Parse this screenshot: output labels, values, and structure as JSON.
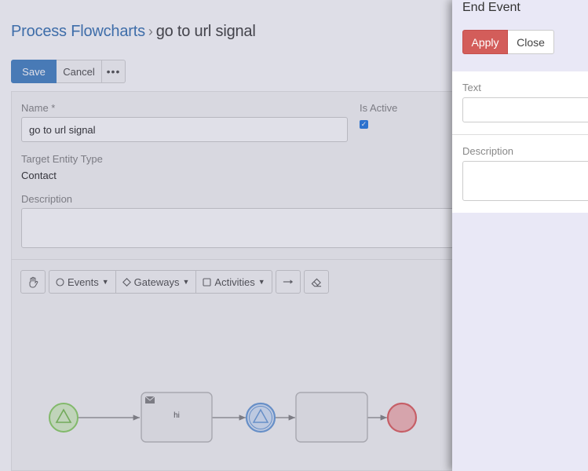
{
  "breadcrumb": {
    "parent": "Process Flowcharts",
    "separator": "›",
    "current": "go to url signal"
  },
  "toolbar": {
    "save_label": "Save",
    "cancel_label": "Cancel",
    "more_label": "•••"
  },
  "form": {
    "name_label": "Name *",
    "name_value": "go to url signal",
    "is_active_label": "Is Active",
    "is_active_checked": true,
    "target_entity_label": "Target Entity Type",
    "target_entity_value": "Contact",
    "description_label": "Description",
    "description_value": ""
  },
  "flow_toolbar": {
    "events_label": "Events",
    "gateways_label": "Gateways",
    "activities_label": "Activities",
    "hand_icon": "hand-icon",
    "connector_icon": "arrow-connector-icon",
    "eraser_icon": "eraser-icon"
  },
  "diagram": {
    "task_label": "hi"
  },
  "side_panel": {
    "title": "End Event",
    "apply_label": "Apply",
    "close_label": "Close",
    "text_label": "Text",
    "text_value": "",
    "description_label": "Description",
    "description_value": ""
  },
  "colors": {
    "accent": "#4b86c4",
    "apply": "#d35d5a",
    "start_event": "#8fd16a",
    "intermediate_event": "#6f9fd8",
    "end_event": "#e06666"
  }
}
